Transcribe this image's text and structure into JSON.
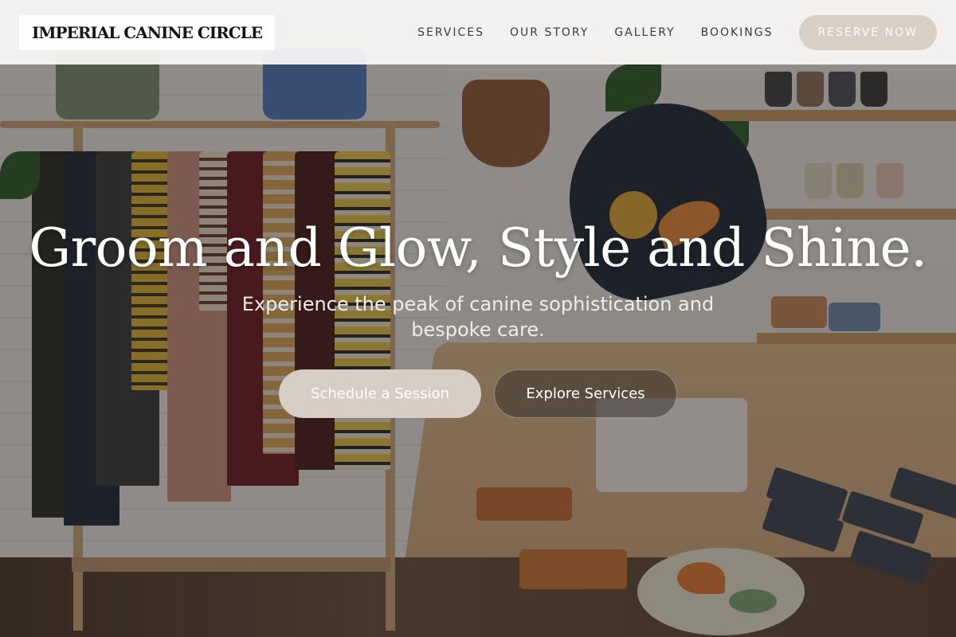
{
  "brand": {
    "name": "IMPERIAL CANINE CIRCLE"
  },
  "nav": {
    "links": [
      "SERVICES",
      "OUR STORY",
      "GALLERY",
      "BOOKINGS"
    ],
    "cta": "RESERVE NOW"
  },
  "hero": {
    "title": "Groom and Glow, Style and Shine.",
    "subtitle": "Experience the peak of canine sophistication and bespoke care.",
    "primary_button": "Schedule a Session",
    "secondary_button": "Explore Services"
  },
  "colors": {
    "accent": "#d6cdc5",
    "header_bg": "#faf9f8",
    "nav_text": "#3b3b3b"
  }
}
